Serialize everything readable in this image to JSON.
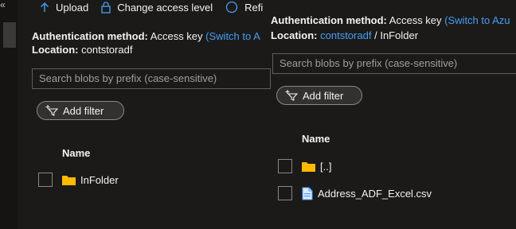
{
  "toolbar": {
    "upload_label": "Upload",
    "change_access_label": "Change access level",
    "refresh_label": "Refi"
  },
  "back_panel": {
    "auth_label": "Authentication method:",
    "auth_value": "Access key",
    "auth_switch_link": "(Switch to A",
    "location_label": "Location:",
    "location_value": "contstoradf",
    "search_placeholder": "Search blobs by prefix (case-sensitive)",
    "add_filter_label": "Add filter",
    "column_name": "Name",
    "rows": [
      {
        "name": "InFolder",
        "icon": "folder-icon"
      }
    ]
  },
  "front_panel": {
    "auth_label": "Authentication method:",
    "auth_value": "Access key",
    "auth_switch_link": "(Switch to Azu",
    "location_label": "Location:",
    "location_container": "contstoradf",
    "location_separator": "/",
    "location_folder": "InFolder",
    "search_placeholder": "Search blobs by prefix (case-sensitive)",
    "add_filter_label": "Add filter",
    "column_name": "Name",
    "rows": [
      {
        "name": "[..]",
        "icon": "folder-icon"
      },
      {
        "name": "Address_ADF_Excel.csv",
        "icon": "file-icon"
      }
    ]
  },
  "colors": {
    "background": "#1b1a19",
    "link": "#479ef5",
    "folder": "#ffb900",
    "text": "#f3f2f1"
  }
}
